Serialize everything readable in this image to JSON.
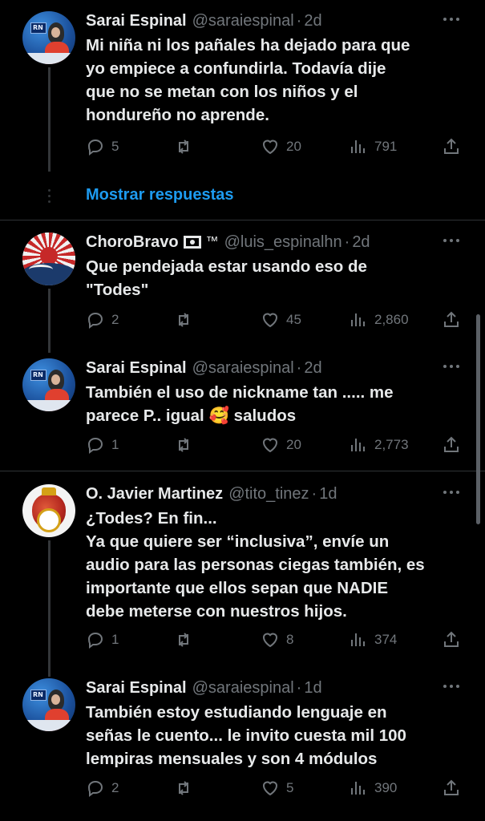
{
  "tweets": [
    {
      "name": "Sarai Espinal",
      "handle": "@saraiespinal",
      "time": "2d",
      "text": "Mi niña ni los pañales ha dejado para que\nyo empiece a confundirla. Todavía dije\nque no se metan con los niños y el\nhondureño no aprende.",
      "replies": "5",
      "retweets": "",
      "likes": "20",
      "views": "791"
    },
    {
      "name": "ChoroBravo",
      "badge": "™",
      "handle": "@luis_espinalhn",
      "time": "2d",
      "text": "Que pendejada estar usando eso de\n\"Todes\"",
      "replies": "2",
      "retweets": "",
      "likes": "45",
      "views": "2,860"
    },
    {
      "name": "Sarai Espinal",
      "handle": "@saraiespinal",
      "time": "2d",
      "text": "También el uso de nickname tan ..... me\nparece P.. igual 🥰 saludos",
      "replies": "1",
      "retweets": "",
      "likes": "20",
      "views": "2,773"
    },
    {
      "name": "O. Javier Martinez",
      "handle": "@tito_tinez",
      "time": "1d",
      "text": "¿Todes? En fin...\nYa que quiere ser “inclusiva”, envíe un\naudio para las personas ciegas también, es\nimportante que ellos sepan que NADIE\ndebe meterse con nuestros hijos.",
      "replies": "1",
      "retweets": "",
      "likes": "8",
      "views": "374"
    },
    {
      "name": "Sarai Espinal",
      "handle": "@saraiespinal",
      "time": "1d",
      "text": "También estoy estudiando lenguaje en\nseñas le cuento... le invito cuesta mil 100\nlempiras mensuales y son 4 módulos",
      "replies": "2",
      "retweets": "",
      "likes": "5",
      "views": "390"
    }
  ],
  "show_replies_label": "Mostrar respuestas",
  "colors": {
    "background": "#000000",
    "text": "#e7e9ea",
    "muted": "#71767b",
    "link": "#1d9bf0"
  },
  "icons": [
    "reply-icon",
    "retweet-icon",
    "like-icon",
    "views-icon",
    "share-icon",
    "more-icon"
  ]
}
